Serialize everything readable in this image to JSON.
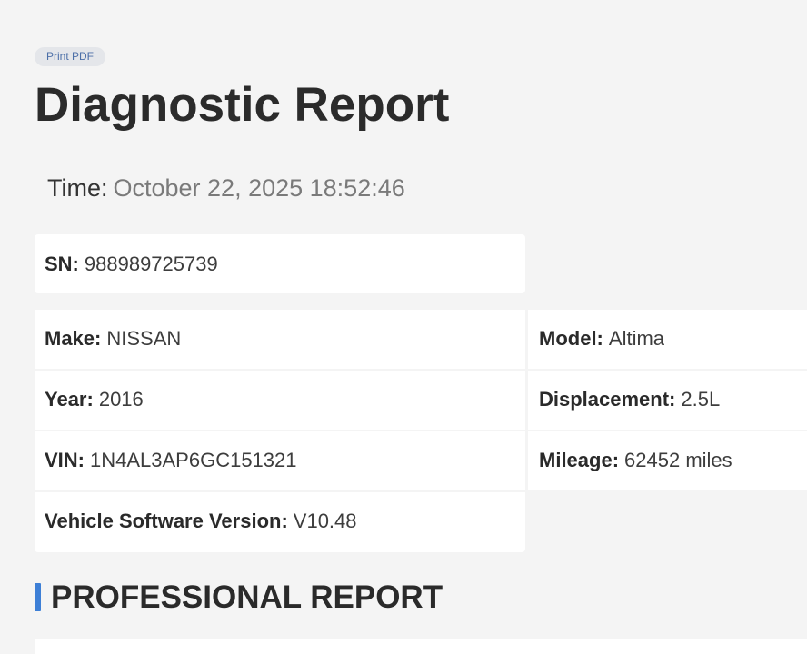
{
  "header": {
    "print_button_label": "Print PDF",
    "title": "Diagnostic Report"
  },
  "time": {
    "label": "Time:",
    "value": "October 22, 2025 18:52:46"
  },
  "serial": {
    "label": "SN:",
    "value": "988989725739"
  },
  "vehicle": {
    "make": {
      "label": "Make:",
      "value": "NISSAN"
    },
    "model": {
      "label": "Model:",
      "value": "Altima"
    },
    "year": {
      "label": "Year:",
      "value": "2016"
    },
    "displacement": {
      "label": "Displacement:",
      "value": "2.5L"
    },
    "vin": {
      "label": "VIN:",
      "value": "1N4AL3AP6GC151321"
    },
    "mileage": {
      "label": "Mileage:",
      "value": "62452 miles"
    },
    "software": {
      "label": "Vehicle Software Version:",
      "value": "V10.48"
    }
  },
  "section": {
    "title": "PROFESSIONAL REPORT"
  },
  "colors": {
    "accent": "#3d7fd6",
    "background": "#f4f4f4",
    "card": "#ffffff"
  }
}
